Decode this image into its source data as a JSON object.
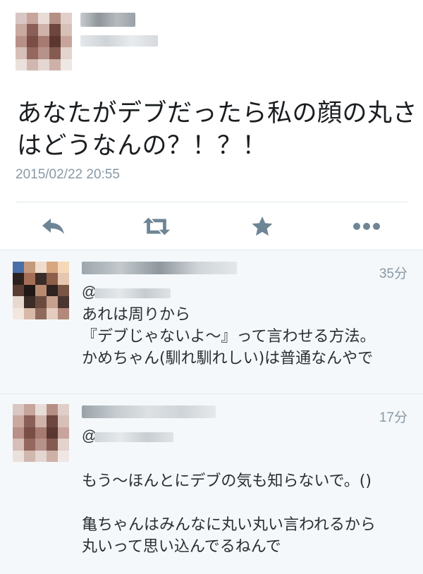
{
  "main_tweet": {
    "text_lines": [
      "あなたがデブだったら私の顔の丸さ",
      "はどうなんの？！？！"
    ],
    "timestamp": "2015/02/22 20:55",
    "actions": [
      {
        "icon": "reply-icon"
      },
      {
        "icon": "retweet-icon"
      },
      {
        "icon": "favorite-icon"
      },
      {
        "icon": "more-icon"
      }
    ]
  },
  "replies": [
    {
      "time": "35分",
      "at": "@",
      "text_lines": [
        "あれは周りから",
        "『デブじゃないよ〜』って言わせる方法。",
        "かめちゃん(馴れ馴れしい)は普通なんやで"
      ]
    },
    {
      "time": "17分",
      "at": "@",
      "text_lines": [
        "もう〜ほんとにデブの気も知らないで。()",
        "",
        "亀ちゃんはみんなに丸い丸い言われるから",
        "丸いって思い込んでるねんで"
      ]
    }
  ],
  "colors": {
    "text": "#292f33",
    "muted": "#8899a6",
    "reply_bg": "#f5f8fa",
    "divider": "#e1e8ed",
    "icon": "#6e8596"
  }
}
